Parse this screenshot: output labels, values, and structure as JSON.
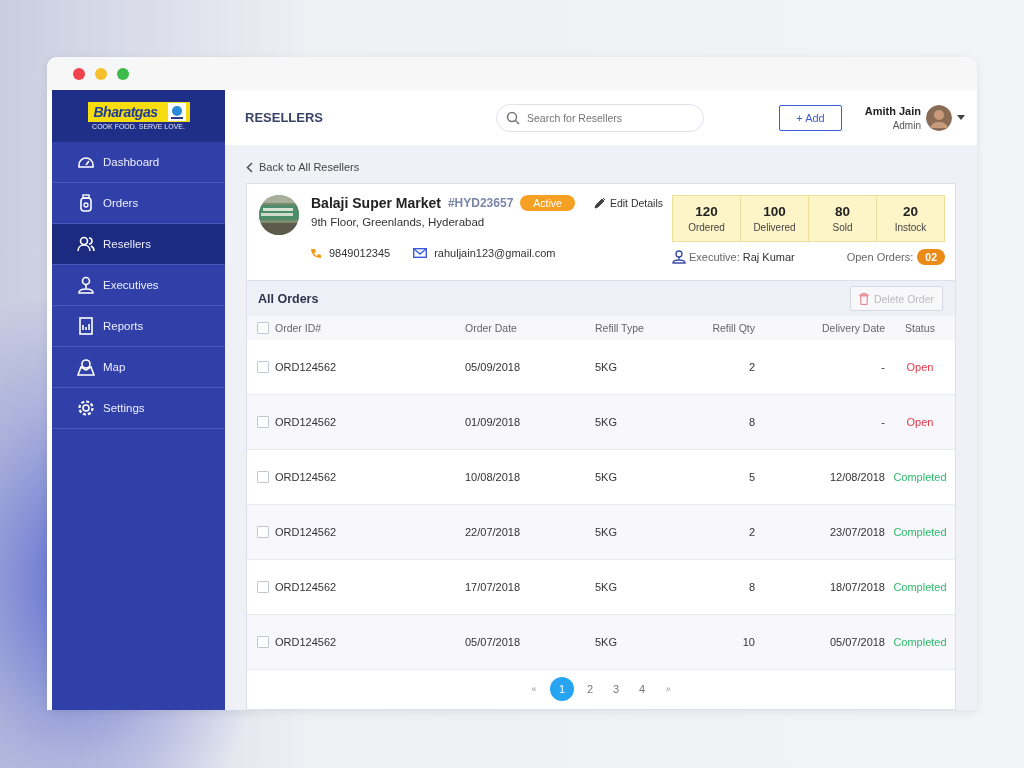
{
  "window": {
    "controls": [
      {
        "kind": "close"
      },
      {
        "kind": "minimize"
      },
      {
        "kind": "maximize"
      }
    ]
  },
  "sidebar": {
    "logo": {
      "name": "Bharatgas",
      "tagline": "COOK FOOD. SERVE LOVE."
    },
    "items": [
      {
        "label": "Dashboard",
        "selected": false
      },
      {
        "label": "Orders",
        "selected": false
      },
      {
        "label": "Resellers",
        "selected": true
      },
      {
        "label": "Executives",
        "selected": false
      },
      {
        "label": "Reports",
        "selected": false
      },
      {
        "label": "Map",
        "selected": false
      },
      {
        "label": "Settings",
        "selected": false
      }
    ]
  },
  "header": {
    "title": "RESELLERS",
    "search": {
      "placeholder": "Search for Resellers"
    },
    "add_button": "+ Add",
    "user": {
      "name": "Amith Jain",
      "role": "Admin"
    }
  },
  "back_link": "Back to All Resellers",
  "reseller": {
    "name": "Balaji Super Market",
    "code": "#HYD23657",
    "status": "Active",
    "edit": "Edit Details",
    "address": "9th Floor, Greenlands, Hyderabad",
    "phone": "9849012345",
    "email": "rahuljain123@gmail.com",
    "stats": [
      {
        "value": "120",
        "label": "Ordered"
      },
      {
        "value": "100",
        "label": "Delivered"
      },
      {
        "value": "80",
        "label": "Sold"
      },
      {
        "value": "20",
        "label": "Instock"
      }
    ],
    "executive_label": "Executive:",
    "executive": "Raj Kumar",
    "open_orders_label": "Open Orders:",
    "open_orders": "02"
  },
  "orders": {
    "title": "All Orders",
    "delete_button": {
      "label": "Delete Order",
      "disabled": true
    },
    "columns": [
      "Order ID#",
      "Order Date",
      "Refill Type",
      "Refill Qty",
      "Delivery Date",
      "Status"
    ],
    "select_all": {
      "checked": false
    },
    "rows": [
      {
        "checked": false,
        "id": "ORD124562",
        "date": "05/09/2018",
        "type": "5KG",
        "qty": "2",
        "delivery": "-",
        "status": "Open",
        "color": "#e8394a"
      },
      {
        "checked": false,
        "id": "ORD124562",
        "date": "01/09/2018",
        "type": "5KG",
        "qty": "8",
        "delivery": "-",
        "status": "Open",
        "color": "#e8394a"
      },
      {
        "checked": false,
        "id": "ORD124562",
        "date": "10/08/2018",
        "type": "5KG",
        "qty": "5",
        "delivery": "12/08/2018",
        "status": "Completed",
        "color": "#2bbb6a"
      },
      {
        "checked": false,
        "id": "ORD124562",
        "date": "22/07/2018",
        "type": "5KG",
        "qty": "2",
        "delivery": "23/07/2018",
        "status": "Completed",
        "color": "#2bbb6a"
      },
      {
        "checked": false,
        "id": "ORD124562",
        "date": "17/07/2018",
        "type": "5KG",
        "qty": "8",
        "delivery": "18/07/2018",
        "status": "Completed",
        "color": "#2bbb6a"
      },
      {
        "checked": false,
        "id": "ORD124562",
        "date": "05/07/2018",
        "type": "5KG",
        "qty": "10",
        "delivery": "05/07/2018",
        "status": "Completed",
        "color": "#2bbb6a"
      }
    ],
    "pagination": {
      "prev": "«",
      "next": "»",
      "pages": [
        {
          "label": "1",
          "selected": true
        },
        {
          "label": "2",
          "selected": false
        },
        {
          "label": "3",
          "selected": false
        },
        {
          "label": "4",
          "selected": false
        }
      ]
    }
  }
}
